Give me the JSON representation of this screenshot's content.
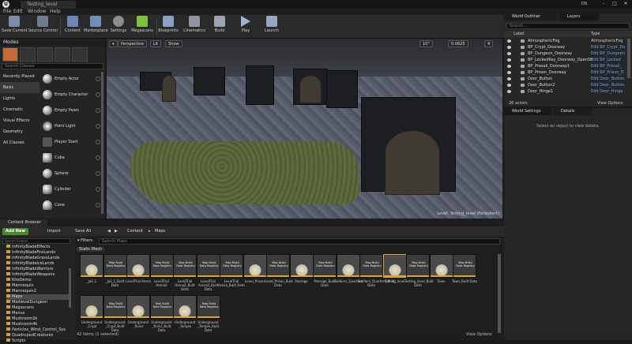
{
  "window": {
    "tab_title": "Testing_level",
    "user_badge": "DS"
  },
  "menu": [
    "File",
    "Edit",
    "Window",
    "Help"
  ],
  "toolbar": [
    {
      "label": "Save Current",
      "color": "#7a8da8"
    },
    {
      "label": "Source Control",
      "color": "#6f7c8e"
    },
    {
      "label": "Content",
      "color": "#6d86b3"
    },
    {
      "label": "Marketplace",
      "color": "#6f8fb9"
    },
    {
      "label": "Settings",
      "color": "#8d8d8d"
    },
    {
      "label": "Megascans",
      "color": "#7fc241"
    },
    {
      "label": "Blueprints",
      "color": "#8aa0c4"
    },
    {
      "label": "Cinematics",
      "color": "#8f95a3"
    },
    {
      "label": "Build",
      "color": "#9aa4b4"
    },
    {
      "label": "Play",
      "color": "#9fb2cf"
    },
    {
      "label": "Launch",
      "color": "#97a6bf"
    }
  ],
  "modes": {
    "title": "Modes",
    "search_placeholder": "Search Classes",
    "categories": [
      "Recently Placed",
      "Basic",
      "Lights",
      "Cinematic",
      "Visual Effects",
      "Geometry",
      "All Classes"
    ],
    "selected_category": "Basic",
    "items": [
      "Empty Actor",
      "Empty Character",
      "Empty Pawn",
      "Point Light",
      "Player Start",
      "Cube",
      "Sphere",
      "Cylinder",
      "Cone"
    ]
  },
  "viewport": {
    "perspective": "Perspective",
    "lit": "Lit",
    "show": "Show",
    "snap_angle": "10°",
    "snap_scale": "0.0625",
    "camera_speed": "4",
    "level_label": "Level:",
    "level_name": "Testing_level (Persistent)"
  },
  "outliner": {
    "tab1": "World Outliner",
    "tab2": "Layers",
    "search_placeholder": "Search...",
    "col_label": "Label",
    "col_type": "Type",
    "rows": [
      {
        "name": "AtmosphericFog",
        "type": "AtmosphericFog"
      },
      {
        "name": "BP_Crypt_Doorway",
        "type": "Edit BP_Crypt_Do"
      },
      {
        "name": "BP_Dungeon_Doorway",
        "type": "Edit BP_Dungeon"
      },
      {
        "name": "BP_LockedKey_Doorway_OpenSh",
        "type": "Edit BP_Locked"
      },
      {
        "name": "BP_Presall_Doorway1",
        "type": "Edit BP_Presall_"
      },
      {
        "name": "BP_Prison_Doorway",
        "type": "Edit BP_Prison_D"
      },
      {
        "name": "Door_Button",
        "type": "Edit Door_Button"
      },
      {
        "name": "Door_Button2",
        "type": "Edit Door_Button"
      },
      {
        "name": "Door_Hinge1",
        "type": "Edit Door_Hinge"
      }
    ],
    "count": "26 actors",
    "view_options": "View Options"
  },
  "details": {
    "tab1": "World Settings",
    "tab2": "Details",
    "empty": "Select an object to view details."
  },
  "content_browser": {
    "tab": "Content Browser",
    "add_new": "Add New",
    "import": "Import",
    "save_all": "Save All",
    "path": [
      "Content",
      "Maps"
    ],
    "filters": "Filters",
    "search_placeholder": "Search Maps",
    "tree_search_placeholder": "Search Folders",
    "tree": [
      "InfinityBladeEffects",
      "InfinityBladeFireLands",
      "InfinityBladeGrassLands",
      "InfinityBladeIceLands",
      "InfinityBladeWarriors",
      "InfinityBladeWeapons",
      "KiteDemo",
      "Mannequin",
      "Mannequin2",
      "Maps",
      "MedievalDungeon",
      "Megascans",
      "Menus",
      "Mushroom2k",
      "Mushroom4k",
      "Particles_Wind_Control_Sys",
      "QuadrupedCreatures",
      "Scripts"
    ],
    "selected_tree": "Maps",
    "filter_chip": "Static Mesh",
    "assets_row1": [
      {
        "thumb": "",
        "cap": "_Jail_1"
      },
      {
        "thumb": "Map Build Data Registry",
        "cap": "_Jail_1_Built Data"
      },
      {
        "thumb": "",
        "cap": "LevelTrial Arena"
      },
      {
        "thumb": "Map Build Data Registry",
        "cap": "LevelTrial Arena2"
      },
      {
        "thumb": "Map Build Data Registry",
        "cap": "LevelTrial Arena2_Built Data"
      },
      {
        "thumb": "Map Build Data Registry",
        "cap": "LevelTrial Arena3_Built Data"
      },
      {
        "thumb": "Map Build Data Registry",
        "cap": "LevelTrial Arena_Built Data"
      },
      {
        "thumb": "",
        "cap": "Level_Prison"
      },
      {
        "thumb": "Map Build Data Registry",
        "cap": "Level_Prison_Built Data"
      },
      {
        "thumb": "",
        "cap": "Passage"
      },
      {
        "thumb": "Map Build Data Registry",
        "cap": "Passage_Built Data"
      },
      {
        "thumb": "",
        "cap": "Soldiers_Quarters"
      },
      {
        "thumb": "Map Build Data Registry",
        "cap": "Soldiers_Quarters_Built Data"
      },
      {
        "thumb": "",
        "cap": "Testing_level"
      },
      {
        "thumb": "Map Build Data Registry",
        "cap": "Testing_level_Built Data"
      },
      {
        "thumb": "",
        "cap": "Town"
      },
      {
        "thumb": "Map Build Data Registry",
        "cap": "Town_Built Data"
      }
    ],
    "assets_row2": [
      {
        "thumb": "",
        "cap": "Underground _Crypt"
      },
      {
        "thumb": "Map Build Data Registry",
        "cap": "Underground _Crypt_Built Data"
      },
      {
        "thumb": "",
        "cap": "Underground _Ruins"
      },
      {
        "thumb": "Map Build Data Registry",
        "cap": "Underground _Ruins_Built Data"
      },
      {
        "thumb": "",
        "cap": "Underground _Temple"
      },
      {
        "thumb": "Map Build Data Registry",
        "cap": "Underground _Temple_Built Data"
      }
    ],
    "selected_asset": "Testing_level",
    "status": "42 items (1 selected)",
    "view_options": "View Options"
  }
}
